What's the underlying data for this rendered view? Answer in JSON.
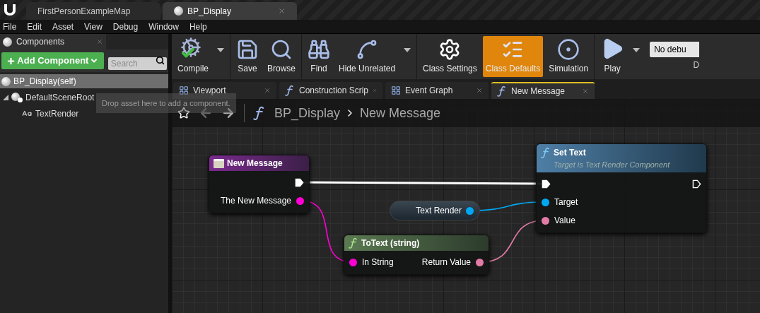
{
  "document_tabs": [
    {
      "label": "FirstPersonExampleMap",
      "selected": false
    },
    {
      "label": "BP_Display",
      "selected": true
    }
  ],
  "menu": [
    "File",
    "Edit",
    "Asset",
    "View",
    "Debug",
    "Window",
    "Help"
  ],
  "components_panel": {
    "title": "Components",
    "add_button": "Add Component",
    "search": {
      "placeholder": "Search"
    },
    "items": [
      {
        "label": "BP_Display(self)",
        "kind": "actor",
        "selected": true
      },
      {
        "label": "DefaultSceneRoot",
        "kind": "scene",
        "selected": false,
        "expanded": true,
        "children": [
          {
            "label": "TextRender",
            "kind": "text",
            "selected": false
          }
        ]
      }
    ],
    "drop_hint": "Drop asset here to add a component."
  },
  "toolbar": {
    "groups": [
      [
        {
          "label": "Compile",
          "kind": "compile",
          "dropdown": true,
          "selected": false
        }
      ],
      [
        {
          "label": "Save",
          "kind": "save",
          "dropdown": false,
          "selected": false
        },
        {
          "label": "Browse",
          "kind": "browse",
          "dropdown": false,
          "selected": false
        }
      ],
      [
        {
          "label": "Find",
          "kind": "find",
          "dropdown": false,
          "selected": false
        },
        {
          "label": "Hide Unrelated",
          "kind": "hide",
          "dropdown": true,
          "selected": false
        }
      ],
      [
        {
          "label": "Class Settings",
          "kind": "settings",
          "dropdown": false,
          "selected": false
        },
        {
          "label": "Class Defaults",
          "kind": "defaults",
          "dropdown": false,
          "selected": true
        },
        {
          "label": "Simulation",
          "kind": "simulation",
          "dropdown": false,
          "selected": false
        }
      ],
      [
        {
          "label": "Play",
          "kind": "play",
          "dropdown": true,
          "selected": false
        }
      ]
    ],
    "debug_filter": {
      "value": "No debu",
      "label": "D"
    }
  },
  "graph_tabs": [
    {
      "label": "Viewport",
      "kind": "viewport",
      "selected": false
    },
    {
      "label": "Construction Scrip",
      "kind": "function",
      "selected": false
    },
    {
      "label": "Event Graph",
      "kind": "graph",
      "selected": false
    },
    {
      "label": "New Message",
      "kind": "function",
      "selected": true
    }
  ],
  "breadcrumb": [
    "BP_Display",
    "New Message"
  ],
  "nodes": [
    {
      "kind": "event",
      "title": "New Message",
      "outputs": [
        {
          "kind": "exec",
          "connected": true
        },
        {
          "kind": "data",
          "label": "The New Message",
          "color": "#ff00d4"
        }
      ]
    },
    {
      "kind": "variable",
      "title": "Text Render",
      "outputs": [
        {
          "kind": "data",
          "color": "#00a8f3"
        }
      ]
    },
    {
      "kind": "pure_function",
      "title": "ToText (string)",
      "inputs": [
        {
          "kind": "data",
          "label": "In String",
          "color": "#ff00d4"
        }
      ],
      "outputs": [
        {
          "kind": "data",
          "label": "Return Value",
          "color": "#e27ca6"
        }
      ]
    },
    {
      "kind": "function",
      "title": "Set Text",
      "subtitle": "Target is Text Render Component",
      "inputs": [
        {
          "kind": "exec",
          "connected": true
        },
        {
          "kind": "data",
          "label": "Target",
          "color": "#00a8f3"
        },
        {
          "kind": "data",
          "label": "Value",
          "color": "#e27ca6"
        }
      ],
      "outputs": [
        {
          "kind": "exec",
          "connected": false
        }
      ]
    }
  ]
}
